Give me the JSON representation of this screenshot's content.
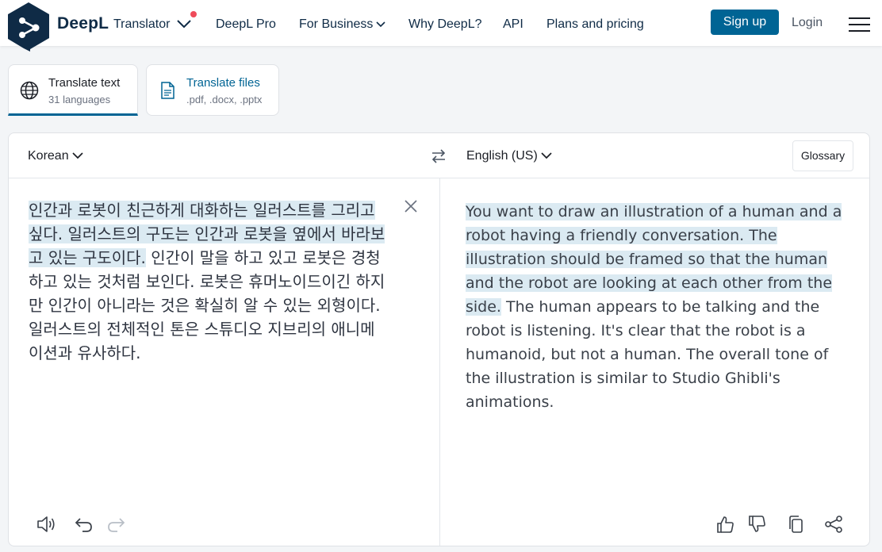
{
  "brand": {
    "name": "DeepL",
    "product": "Translator"
  },
  "nav": {
    "links": [
      "DeepL Pro",
      "For Business",
      "Why DeepL?",
      "API",
      "Plans and pricing"
    ],
    "signup": "Sign up",
    "login": "Login"
  },
  "tabs": [
    {
      "title": "Translate text",
      "subtitle": "31 languages"
    },
    {
      "title": "Translate files",
      "subtitle": ".pdf, .docx, .pptx"
    }
  ],
  "translator": {
    "source_lang": "Korean",
    "target_lang": "English (US)",
    "glossary": "Glossary",
    "source_highlight": "인간과 로봇이 친근하게 대화하는 일러스트를 그리고 싶다. 일러스트의 구도는 인간과 로봇을 옆에서 바라보고 있는 구도이다.",
    "source_rest": " 인간이 말을 하고 있고 로봇은 경청하고 있는 것처럼 보인다. 로봇은 휴머노이드이긴 하지만 인간이 아니라는 것은 확실히 알 수 있는 외형이다. 일러스트의 전체적인 톤은 스튜디오 지브리의 애니메이션과 유사하다.",
    "target_highlight": "You want to draw an illustration of a human and a robot having a friendly conversation. The illustration should be framed so that the human and the robot are looking at each other from the side.",
    "target_rest": " The human appears to be talking and the robot is listening. It's clear that the robot is a humanoid, but not a human. The overall tone of the illustration is similar to Studio Ghibli's animations."
  },
  "icons": {
    "logo": "deepl-logo-icon",
    "product_chevron": "chevron-down-icon",
    "menu": "hamburger-menu-icon",
    "translate_text": "globe-icon",
    "translate_files": "document-icon",
    "swap": "swap-languages-icon",
    "clear": "close-icon",
    "listen": "speaker-icon",
    "undo": "undo-icon",
    "redo": "redo-icon",
    "like": "thumbs-up-icon",
    "dislike": "thumbs-down-icon",
    "copy": "copy-icon",
    "share": "share-icon"
  },
  "colors": {
    "brand_navy": "#0f2b46",
    "accent": "#006494",
    "highlight": "#dbeaf2",
    "notification": "#ef4b5a"
  }
}
